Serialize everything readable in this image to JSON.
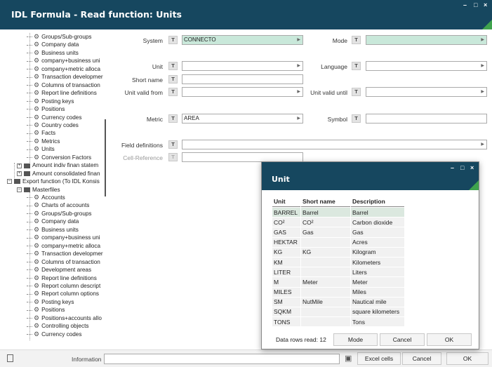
{
  "window": {
    "title": "IDL Formula - Read function: Units"
  },
  "tree": {
    "items": [
      {
        "label": "Groups/Sub-groups",
        "kind": "gear"
      },
      {
        "label": "Company data",
        "kind": "gear"
      },
      {
        "label": "Business units",
        "kind": "gear"
      },
      {
        "label": "company+business uni",
        "kind": "gear"
      },
      {
        "label": "company+metric alloca",
        "kind": "gear"
      },
      {
        "label": "Transaction developmer",
        "kind": "gear"
      },
      {
        "label": "Columns of transaction",
        "kind": "gear"
      },
      {
        "label": "Report line definitions",
        "kind": "gear"
      },
      {
        "label": "Posting keys",
        "kind": "gear"
      },
      {
        "label": "Positions",
        "kind": "gear"
      },
      {
        "label": "Currency codes",
        "kind": "gear"
      },
      {
        "label": "Country codes",
        "kind": "gear"
      },
      {
        "label": "Facts",
        "kind": "gear"
      },
      {
        "label": "Metrics",
        "kind": "gear"
      },
      {
        "label": "Units",
        "kind": "gear"
      },
      {
        "label": "Conversion Factors",
        "kind": "gear"
      },
      {
        "label": "Amount indiv finan statem",
        "kind": "folder"
      },
      {
        "label": "Amount consolidated finan",
        "kind": "folder"
      },
      {
        "label": "Export function (To IDL Konsis",
        "kind": "folder-open"
      },
      {
        "label": "Masterfiles",
        "kind": "folder-open2"
      },
      {
        "label": "Accounts",
        "kind": "gear"
      },
      {
        "label": "Charts of accounts",
        "kind": "gear"
      },
      {
        "label": "Groups/Sub-groups",
        "kind": "gear"
      },
      {
        "label": "Company data",
        "kind": "gear"
      },
      {
        "label": "Business units",
        "kind": "gear"
      },
      {
        "label": "company+business uni",
        "kind": "gear"
      },
      {
        "label": "company+metric alloca",
        "kind": "gear"
      },
      {
        "label": "Transaction developmer",
        "kind": "gear"
      },
      {
        "label": "Columns of transaction",
        "kind": "gear"
      },
      {
        "label": "Development areas",
        "kind": "gear"
      },
      {
        "label": "Report line definitions",
        "kind": "gear"
      },
      {
        "label": "Report column descript",
        "kind": "gear"
      },
      {
        "label": "Report column options",
        "kind": "gear"
      },
      {
        "label": "Posting keys",
        "kind": "gear"
      },
      {
        "label": "Positions",
        "kind": "gear"
      },
      {
        "label": "Positions+accounts allo",
        "kind": "gear"
      },
      {
        "label": "Controlling objects",
        "kind": "gear"
      },
      {
        "label": "Currency codes",
        "kind": "gear"
      }
    ]
  },
  "form": {
    "system_label": "System",
    "system_value": "CONNECTO",
    "mode_label": "Mode",
    "mode_value": "",
    "unit_label": "Unit",
    "unit_value": "",
    "language_label": "Language",
    "language_value": "",
    "short_name_label": "Short name",
    "short_name_value": "",
    "unit_valid_from_label": "Unit valid from",
    "unit_valid_from_value": "",
    "unit_valid_until_label": "Unit valid until",
    "unit_valid_until_value": "",
    "metric_label": "Metric",
    "metric_value": "AREA",
    "symbol_label": "Symbol",
    "symbol_value": "",
    "field_definitions_label": "Field definitions",
    "field_definitions_value": "",
    "cell_reference_label": "Cell-Reference",
    "cell_reference_value": "",
    "t_label": "T"
  },
  "bottom": {
    "information_label": "Information",
    "information_value": "",
    "excel_cells_label": "Excel cells",
    "cancel_label": "Cancel",
    "ok_label": "OK"
  },
  "dialog": {
    "title": "Unit",
    "columns": [
      "Unit",
      "Short name",
      "Description"
    ],
    "rows": [
      [
        "BARREL",
        "Barrel",
        "Barrel"
      ],
      [
        "CO²",
        "CO²",
        "Carbon dioxide"
      ],
      [
        "GAS",
        "Gas",
        "Gas"
      ],
      [
        "HEKTAR",
        "",
        "Acres"
      ],
      [
        "KG",
        "KG",
        "Kilogram"
      ],
      [
        "KM",
        "",
        "Kilometers"
      ],
      [
        "LITER",
        "",
        "Liters"
      ],
      [
        "M",
        "Meter",
        "Meter"
      ],
      [
        "MILES",
        "",
        "Miles"
      ],
      [
        "SM",
        "NutMile",
        "Nautical mile"
      ],
      [
        "SQKM",
        "",
        "square kilometers"
      ],
      [
        "TONS",
        "",
        "Tons"
      ]
    ],
    "rows_read_label": "Data rows read: 12",
    "mode_label": "Mode",
    "cancel_label": "Cancel",
    "ok_label": "OK"
  },
  "colors": {
    "titlebar": "#16475f",
    "accent": "#3fa34d",
    "selected_field": "#c9e8da"
  }
}
